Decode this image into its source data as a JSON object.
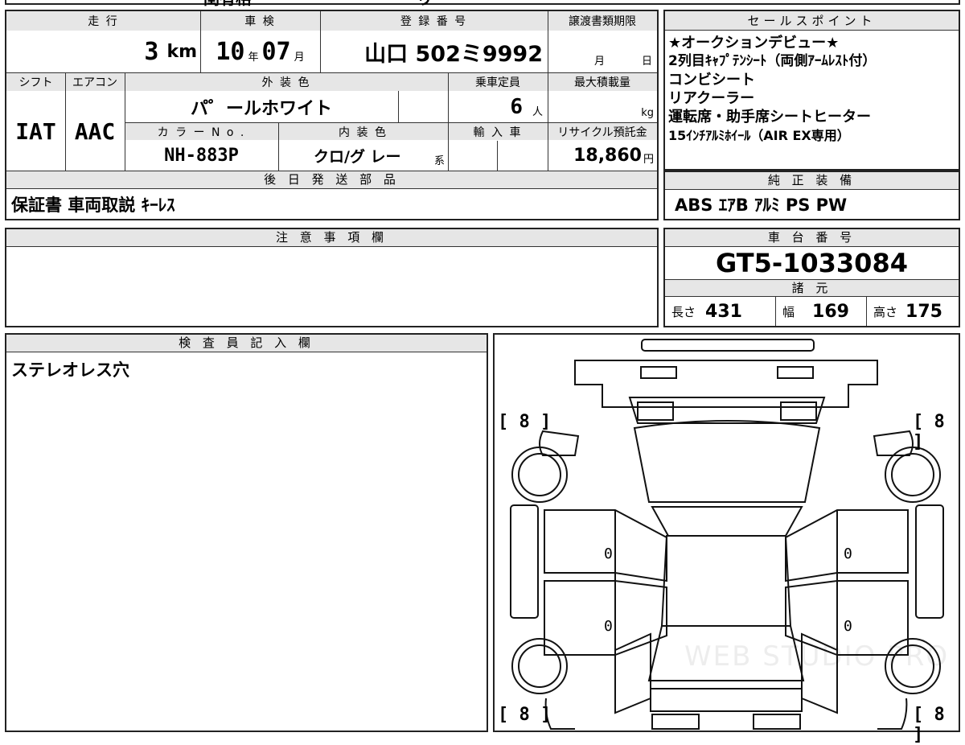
{
  "top_strip_fragments": [
    "閏有格",
    "り"
  ],
  "main": {
    "headers": {
      "mileage": "走 行",
      "inspection": "車 検",
      "registration": "登 録 番 号",
      "transfer_deadline": "譲渡書類期限"
    },
    "mileage_value": "3",
    "mileage_unit": "km",
    "inspection_year": "10",
    "inspection_year_unit": "年",
    "inspection_month": "07",
    "inspection_month_unit": "月",
    "registration_value": "山口 502ミ9992",
    "deadline_month": "月",
    "deadline_day": "日",
    "row2_headers": {
      "shift": "シフト",
      "aircon": "エアコン",
      "exterior_color": "外 装 色",
      "capacity": "乗車定員",
      "max_load": "最大積載量"
    },
    "shift_value": "IAT",
    "aircon_value": "AAC",
    "exterior_color_value": "パ゜ールホワイト",
    "capacity_value": "6",
    "capacity_unit": "人",
    "max_load_unit": "kg",
    "row3_headers": {
      "color_no": "カ ラ ー N o .",
      "interior_color": "内 装 色",
      "import": "輸 入 車",
      "recycle": "リサイクル預託金"
    },
    "color_no_value": "NH-883P",
    "interior_color_value": "クロ/グ レー",
    "interior_suffix": "系",
    "recycle_value": "18,860",
    "recycle_unit": "円",
    "later_parts_header": "後 日 発 送 部 品",
    "later_parts_value": "保証書 車両取説 ｷｰﾚｽ"
  },
  "sales": {
    "header": "セールスポイント",
    "lines": [
      "★オークションデビュー★",
      "2列目ｷｬﾌﾟﾃﾝｼｰﾄ（両側ｱｰﾑﾚｽﾄ付）",
      "コンビシート",
      "リアクーラー",
      "運転席・助手席シートヒーター",
      "15ｲﾝﾁｱﾙﾐﾎｲｰﾙ（AIR EX専用）"
    ]
  },
  "equipment": {
    "header": "純 正 装 備",
    "value": "ABS ｴｱB ｱﾙﾐ PS PW"
  },
  "notes": {
    "header": "注 意 事 項 欄",
    "value": ""
  },
  "chassis": {
    "header": "車 台 番 号",
    "value": "GT5-1033084"
  },
  "specs": {
    "header": "諸 元",
    "length_label": "長さ",
    "length_value": "431",
    "width_label": "幅",
    "width_value": "169",
    "height_label": "高さ",
    "height_value": "175"
  },
  "inspector": {
    "header": "検 査 員 記 入 欄",
    "value": "ステレオレス穴"
  },
  "diagram": {
    "tread_front_left": "[ 8 ]",
    "tread_front_right": "[ 8 ]",
    "tread_rear_left": "[ 8 ]",
    "tread_rear_right": "[ 8 ]",
    "left_upper": "0",
    "left_lower": "0",
    "right_upper": "0",
    "right_lower": "0",
    "watermark": "WEB STUDIO PRO"
  }
}
